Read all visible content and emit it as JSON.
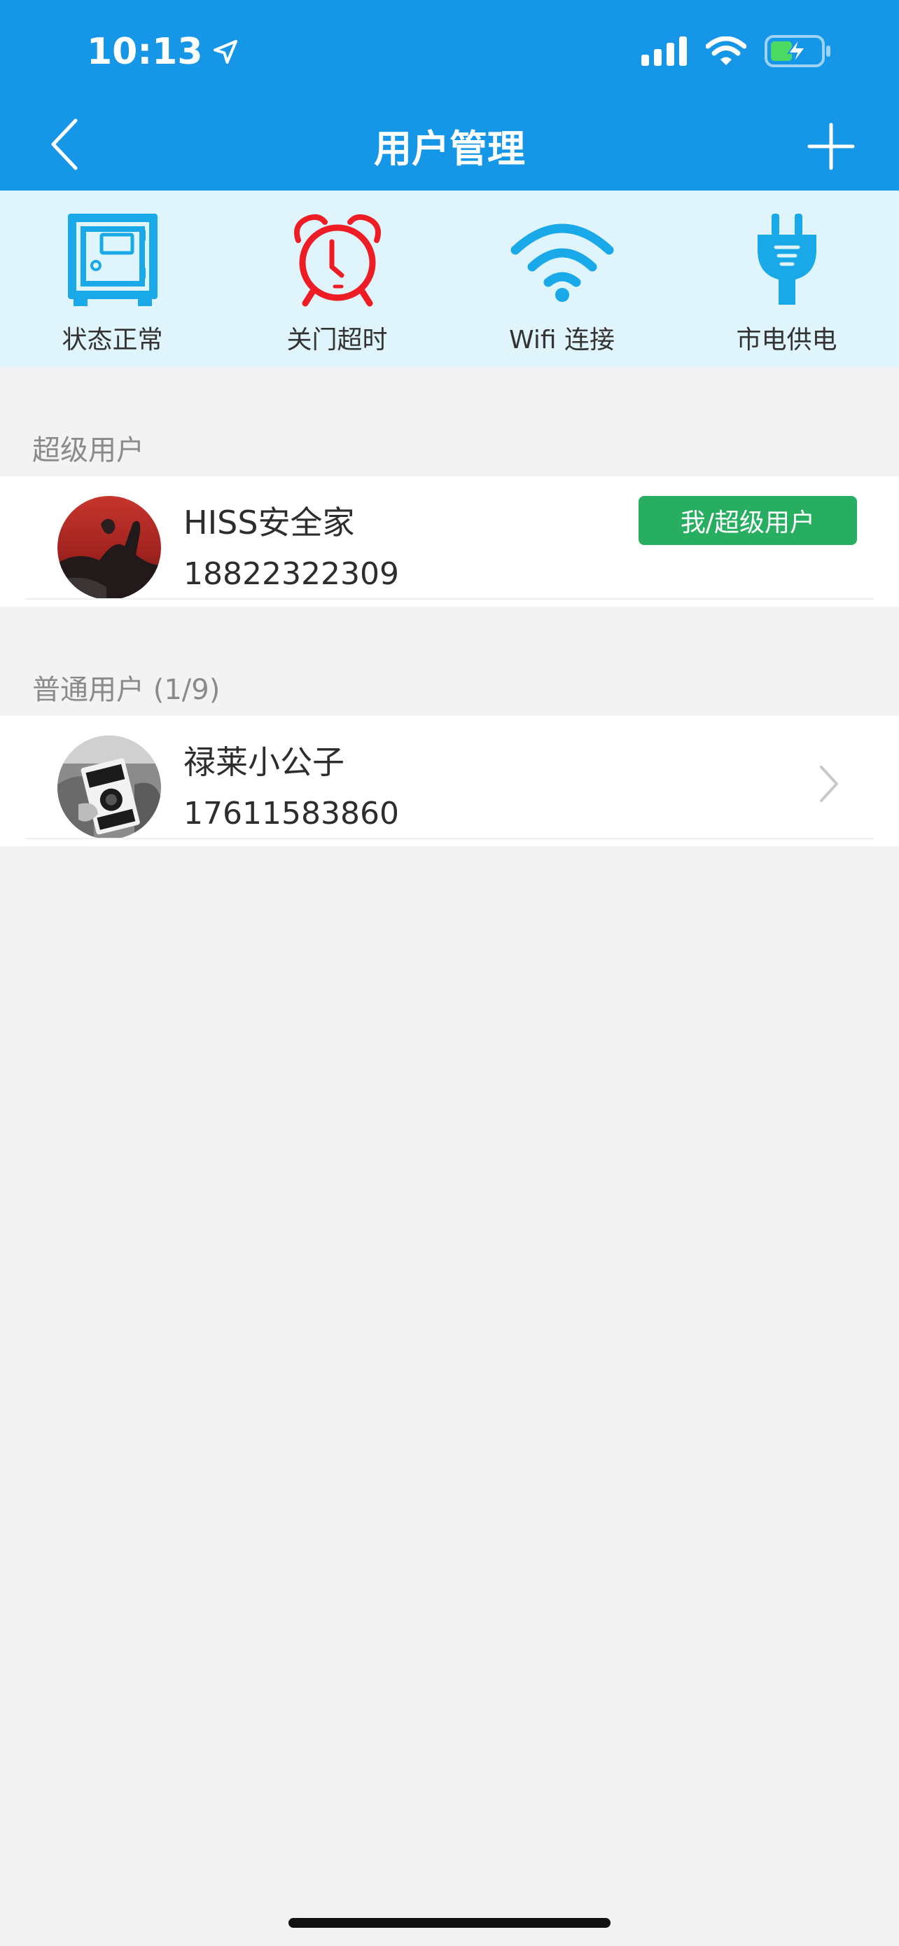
{
  "status_bar": {
    "time": "10:13"
  },
  "nav": {
    "title": "用户管理"
  },
  "quick": [
    {
      "label": "状态正常",
      "icon": "safe-icon",
      "color": "#1aa9e8"
    },
    {
      "label": "关门超时",
      "icon": "alarm-clock-icon",
      "color": "#ee1c24"
    },
    {
      "label": "Wifi 连接",
      "icon": "wifi-icon",
      "color": "#1aa9e8"
    },
    {
      "label": "市电供电",
      "icon": "power-plug-icon",
      "color": "#1aa9e8"
    }
  ],
  "super_section": {
    "title": "超级用户",
    "user": {
      "name": "HISS安全家",
      "phone": "18822322309",
      "badge": "我/超级用户"
    }
  },
  "normal_section": {
    "title": "普通用户 (1/9)",
    "users": [
      {
        "name": "禄莱小公子",
        "phone": "17611583860"
      }
    ]
  },
  "colors": {
    "header": "#1596e6",
    "quick_bg": "#dff4fb",
    "badge": "#27ae60",
    "page_bg": "#f3f3f3"
  }
}
